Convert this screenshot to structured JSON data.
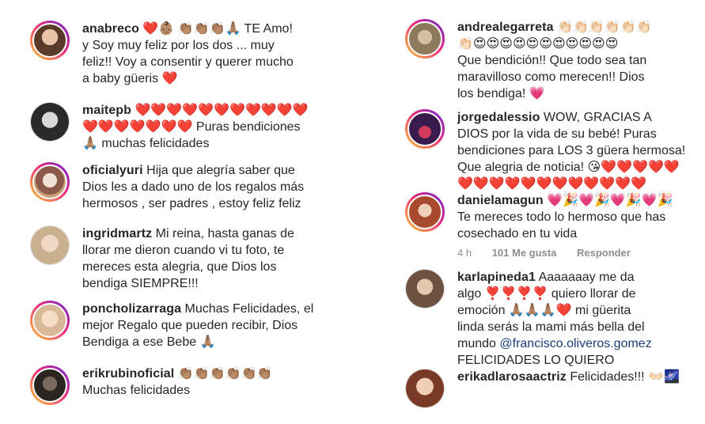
{
  "comments_left": [
    {
      "user": "anabreco",
      "text_a": "❤️👶🏽 👏🏽👏🏽👏🏽🙏🏽 TE Amo!",
      "text_b": "y Soy muy feliz por los dos ... muy",
      "text_c": "feliz!! Voy a consentir y querer mucho",
      "text_d": "a baby güeris ❤️"
    },
    {
      "user": "maitepb",
      "text_a": "❤️❤️❤️❤️❤️❤️❤️❤️❤️❤️❤️",
      "text_b": "❤️❤️❤️❤️❤️❤️❤️ Puras bendiciones",
      "text_c": "🙏🏽 muchas felicidades"
    },
    {
      "user": "oficialyuri",
      "text_a": "Hija que alegría saber que",
      "text_b": "Dios les a dado uno de los regalos más",
      "text_c": "hermosos , ser padres , estoy feliz feliz"
    },
    {
      "user": "ingridmartz",
      "text_a": "Mi reina, hasta ganas de",
      "text_b": "llorar me dieron cuando vi tu foto, te",
      "text_c": "mereces esta alegria, que Dios los",
      "text_d": "bendiga SIEMPRE!!!"
    },
    {
      "user": "poncholizarraga",
      "text_a": "Muchas Felicidades, el",
      "text_b": "mejor Regalo que pueden recibir, Dios",
      "text_c": "Bendiga a ese Bebe 🙏🏽"
    },
    {
      "user": "erikrubinoficial",
      "text_a": "👏🏽👏🏽👏🏽👏🏽👏🏽👏🏽",
      "text_b": "Muchas felicidades"
    }
  ],
  "comments_right": [
    {
      "user": "andrealegarreta",
      "text_a": "👏🏻👏🏻👏🏻👏🏻👏🏻👏🏻",
      "text_b": "👏🏻😍😍😍😍😍😍😍😍😍😍😍",
      "text_c": "Que bendición!! Que todo sea tan",
      "text_d": "maravilloso como merecen!! Dios",
      "text_e": "los bendiga! 💗"
    },
    {
      "user": "jorgedalessio",
      "text_a": "WOW, GRACIAS A",
      "text_b": "DIOS por la vida de su bebé! Puras",
      "text_c": "bendiciones para LOS 3 güera hermosa!",
      "text_d": "Que alegria de noticia! 😘❤️❤️❤️❤️❤️",
      "text_e": "❤️❤️❤️❤️❤️❤️❤️❤️❤️❤️❤️❤️"
    },
    {
      "user": "danielamagun",
      "text_a": "💗🎉💗🎉💗🎉💗🎉",
      "text_b": "Te mereces todo lo hermoso que has",
      "text_c": "cosechado en tu vida",
      "meta_time": "4 h",
      "meta_likes": "101 Me gusta",
      "meta_reply": "Responder"
    },
    {
      "user": "karlapineda1",
      "text_a": "Aaaaaaay me da",
      "text_b": "algo ❣️❣️❣️❣️ quiero llorar de",
      "text_c": "emoción 🙏🏽🙏🏽🙏🏽❤️ mi güerita",
      "text_d": "linda serás la mami más bella del",
      "text_e": "mundo",
      "mention": "@francisco.oliveros.gomez",
      "text_f": "FELICIDADES LO QUIERO"
    },
    {
      "user": "erikadlarosaactriz",
      "text_a": "Felicidades!!! 👐🏻🌌"
    }
  ],
  "colors": {
    "text": "#262626",
    "muted": "#8e8e8e",
    "mention": "#1c3d7a",
    "ring_start": "#f9ce34",
    "ring_mid": "#ee2a7b",
    "ring_end": "#6228d7"
  },
  "avatars": [
    "avatar-photo-woman-dark-hair",
    "avatar-photo-woman-black-white",
    "avatar-photo-woman-face-paint",
    "avatar-photo-woman-blonde",
    "avatar-photo-baby",
    "avatar-photo-man-dark",
    "avatar-photo-woman-hat",
    "avatar-photo-concert-stage",
    "avatar-photo-woman-red-hair",
    "avatar-photo-woman-brown-hair",
    "avatar-photo-woman-smiling"
  ]
}
